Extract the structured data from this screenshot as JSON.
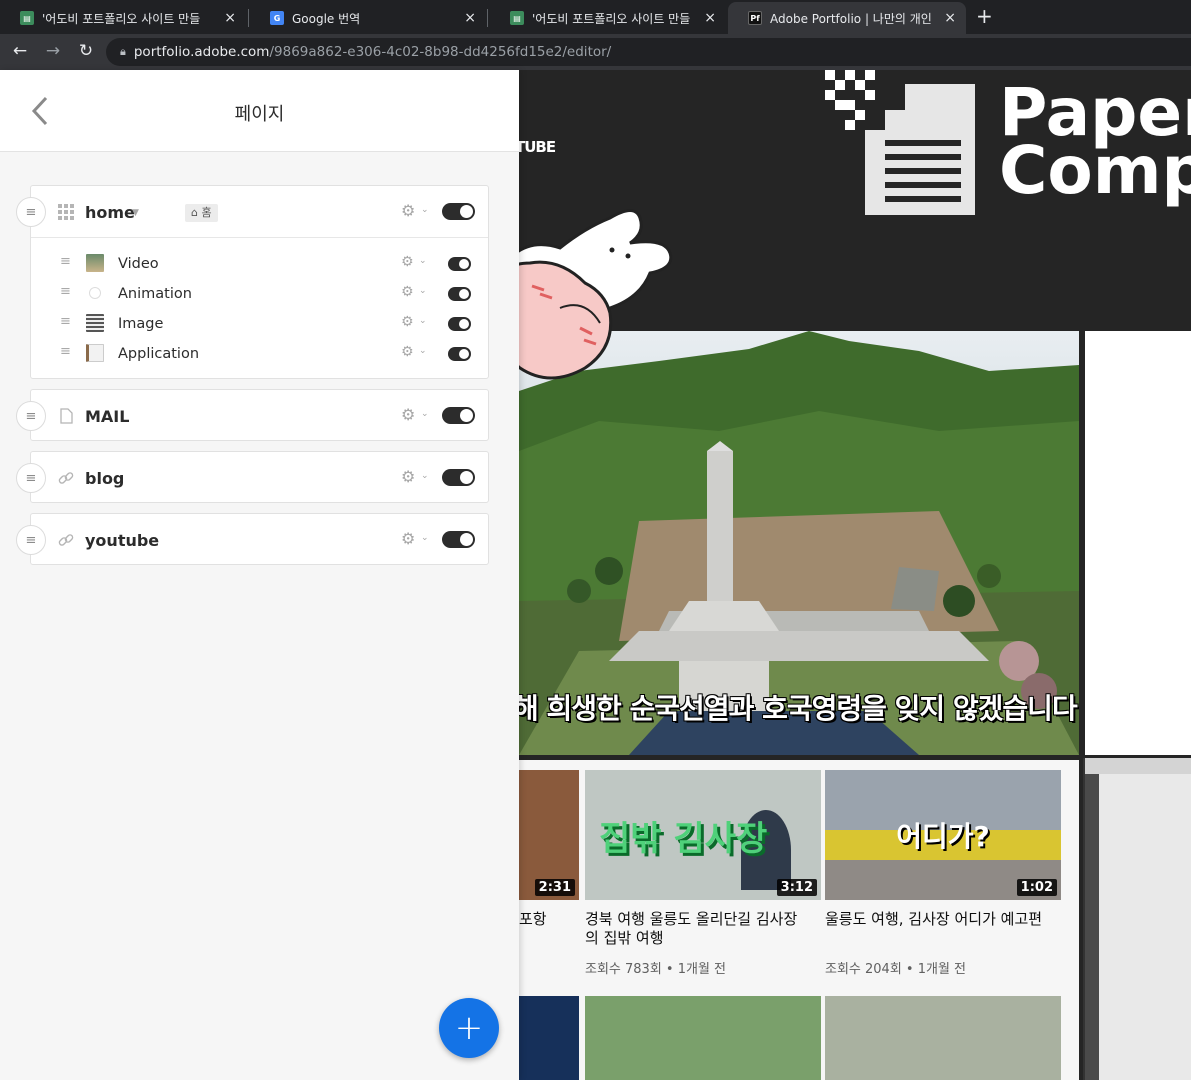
{
  "browser": {
    "tabs": [
      {
        "title": "'어도비 포트폴리오 사이트 만들",
        "favicon": "doc-icon"
      },
      {
        "title": "Google 번역",
        "favicon": "google-translate-icon"
      },
      {
        "title": "'어도비 포트폴리오 사이트 만들",
        "favicon": "doc-icon"
      },
      {
        "title": "Adobe Portfolio | 나만의 개인 웹",
        "favicon": "pf-icon",
        "favicon_text": "Pf"
      }
    ],
    "close_glyph": "×",
    "new_tab_glyph": "+",
    "url_host": "portfolio.adobe.com",
    "url_path": "/9869a862-e306-4c02-8b98-dd4256fd15e2/editor/"
  },
  "panel": {
    "title": "페이지",
    "pages": [
      {
        "name": "home",
        "badge": "홈",
        "icon": "grid-icon",
        "subpages": [
          {
            "name": "Video",
            "icon": "video-thumb"
          },
          {
            "name": "Animation",
            "icon": "animation-thumb"
          },
          {
            "name": "Image",
            "icon": "image-thumb"
          },
          {
            "name": "Application",
            "icon": "application-thumb"
          }
        ]
      },
      {
        "name": "MAIL",
        "icon": "page-icon"
      },
      {
        "name": "blog",
        "icon": "link-icon"
      },
      {
        "name": "youtube",
        "icon": "link-icon"
      }
    ],
    "add_button": "+"
  },
  "preview": {
    "nav_fragment": "TUBE",
    "logo_text": [
      "Paper",
      "Comp"
    ],
    "photo_caption": "해 희생한 순국선열과 호국영령을 잊지 않겠습니다",
    "videos": [
      {
        "thumb_text": "",
        "duration": "2:31",
        "title": "포항",
        "meta": ""
      },
      {
        "thumb_text": "집밖 김사장",
        "duration": "3:12",
        "title": "경북 여행 울릉도 올리단길 김사장의 집밖 여행",
        "meta": "조회수 783회 • 1개월 전"
      },
      {
        "thumb_text": "어디가?",
        "duration": "1:02",
        "title": "울릉도 여행, 김사장 어디가 예고편",
        "meta": "조회수 204회 • 1개월 전"
      }
    ]
  },
  "colors": {
    "accent": "#1473e6",
    "toggle_on": "#2c2c2c",
    "tab_bg": "#202124"
  }
}
